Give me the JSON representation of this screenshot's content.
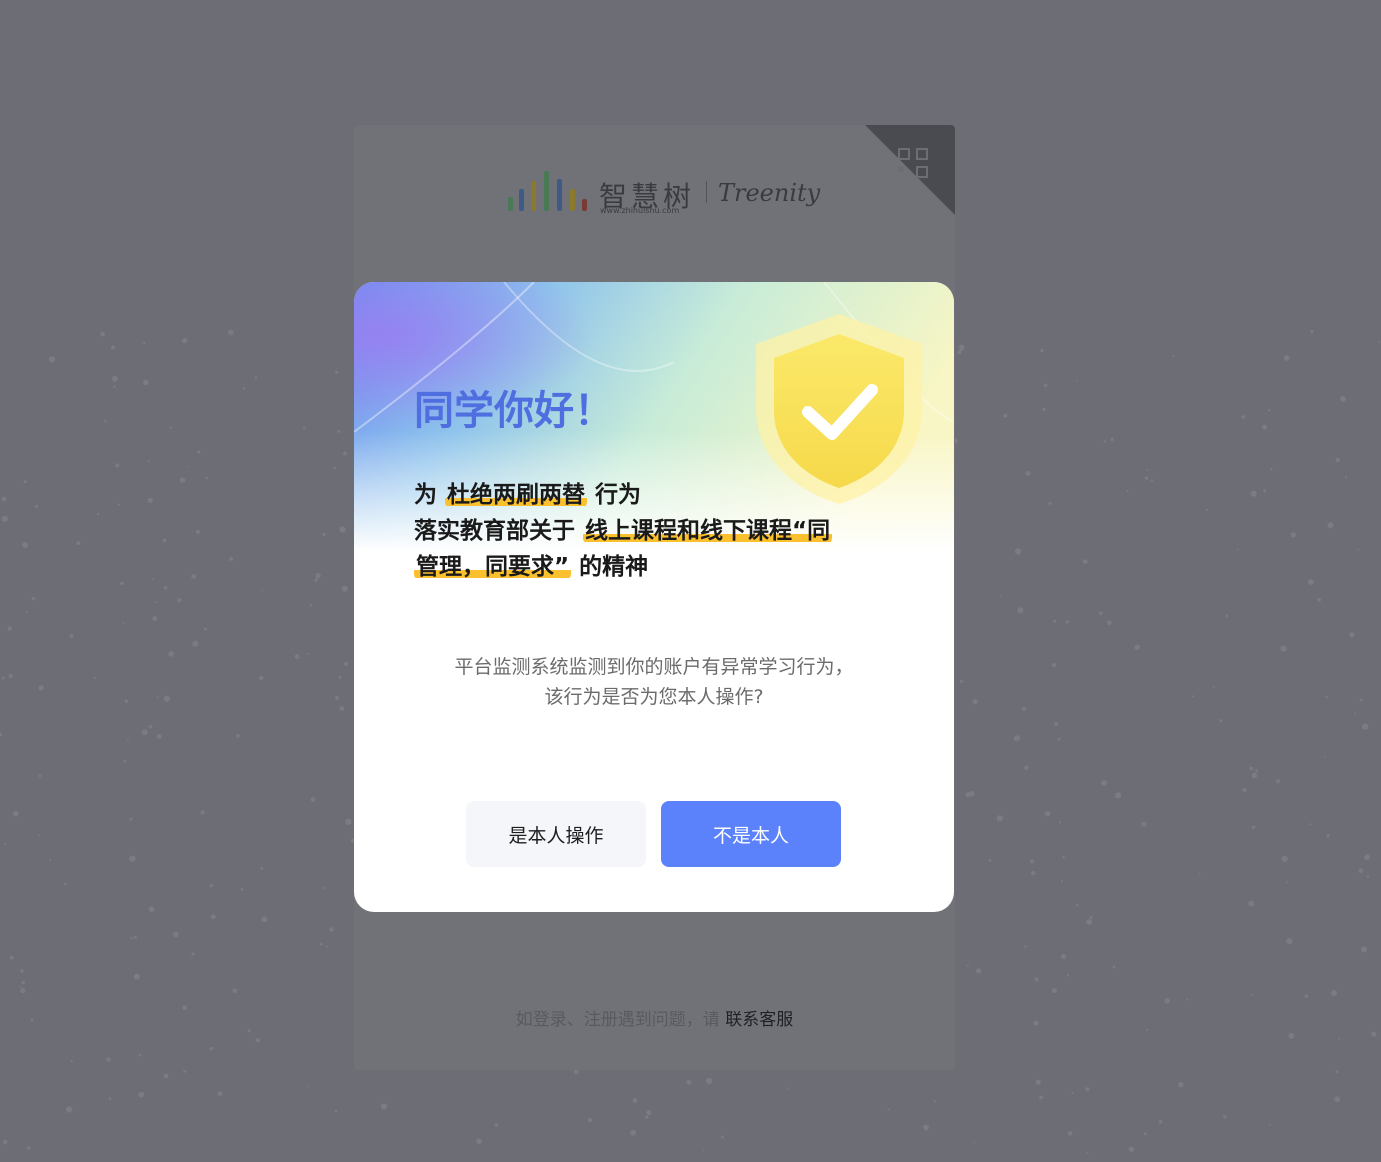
{
  "login": {
    "logo": {
      "name_cn": "智慧树",
      "url": "www.zhihuishu.com",
      "name_en": "Treenity"
    },
    "help": {
      "prefix": "如登录、注册遇到问题，请 ",
      "link": "联系客服"
    }
  },
  "modal": {
    "title": "同学你好！",
    "statement": {
      "l1_a": "为 ",
      "l1_hl": "杜绝两刷两替",
      "l1_b": " 行为",
      "l2_a": "落实教育部关于 ",
      "l2_hl": "线上课程和线下课程“同",
      "l3_hl": "管理，同要求”",
      "l3_b": " 的精神"
    },
    "message_line1": "平台监测系统监测到你的账户有异常学习行为，",
    "message_line2": "该行为是否为您本人操作?",
    "confirm_button": "是本人操作",
    "deny_button": "不是本人"
  },
  "colors": {
    "overlay": "#6d6e75",
    "title": "#4f6fe0",
    "highlight": "#fbc02d",
    "primary_button": "#5b82fb",
    "secondary_button": "#f4f6fa"
  },
  "icons": [
    "qr-code-icon",
    "logo-bars-icon",
    "shield-check-icon"
  ]
}
